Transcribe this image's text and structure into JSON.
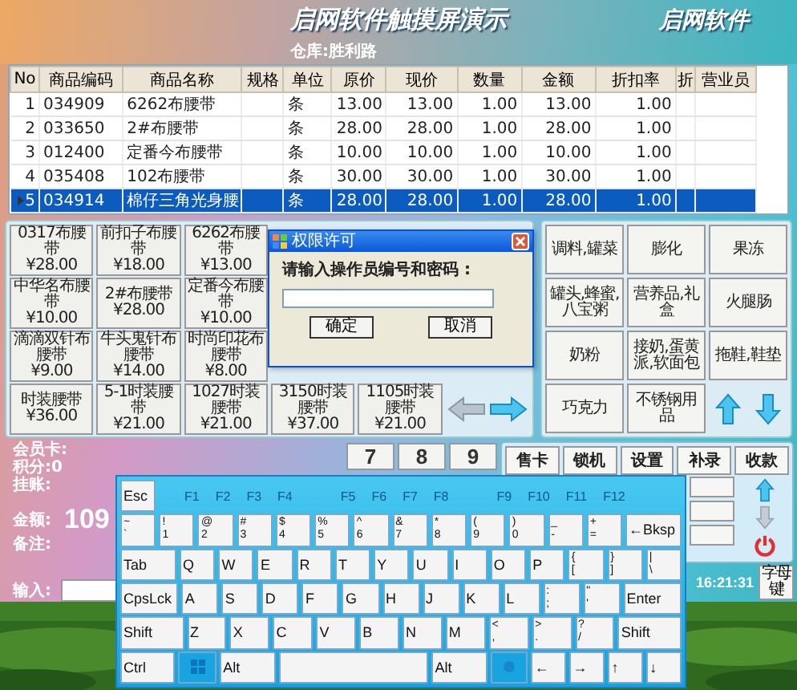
{
  "window": {
    "title": "启网软件触摸屏演示",
    "logo": "启网软件",
    "info": "仓库:胜利路"
  },
  "table": {
    "columns": [
      "No",
      "商品编码",
      "商品名称",
      "规格",
      "单位",
      "原价",
      "现价",
      "数量",
      "金额",
      "折扣率",
      "折",
      "营业员"
    ],
    "rows": [
      {
        "selected": false,
        "cells": [
          "1",
          "034909",
          "6262布腰带",
          "",
          "条",
          "13.00",
          "13.00",
          "1.00",
          "13.00",
          "1.00",
          "",
          ""
        ]
      },
      {
        "selected": false,
        "cells": [
          "2",
          "033650",
          "2#布腰带",
          "",
          "条",
          "28.00",
          "28.00",
          "1.00",
          "28.00",
          "1.00",
          "",
          ""
        ]
      },
      {
        "selected": false,
        "cells": [
          "3",
          "012400",
          "定番今布腰带",
          "",
          "条",
          "10.00",
          "10.00",
          "1.00",
          "10.00",
          "1.00",
          "",
          ""
        ]
      },
      {
        "selected": false,
        "cells": [
          "4",
          "035408",
          "102布腰带",
          "",
          "条",
          "30.00",
          "30.00",
          "1.00",
          "30.00",
          "1.00",
          "",
          ""
        ]
      },
      {
        "selected": true,
        "cells": [
          "5",
          "034914",
          "棉仔三角光身腰",
          "",
          "条",
          "28.00",
          "28.00",
          "1.00",
          "28.00",
          "1.00",
          "",
          ""
        ]
      }
    ]
  },
  "products": [
    [
      {
        "name": "0317布腰带",
        "price": "¥28.00"
      },
      {
        "name": "前扣子布腰带",
        "price": "¥18.00"
      },
      {
        "name": "6262布腰带",
        "price": "¥13.00"
      }
    ],
    [
      {
        "name": "中华名布腰带",
        "price": "¥10.00"
      },
      {
        "name": "2#布腰带",
        "price": "¥28.00"
      },
      {
        "name": "定番今布腰带",
        "price": "¥10.00"
      }
    ],
    [
      {
        "name": "滴滴双针布腰带",
        "price": "¥9.00"
      },
      {
        "name": "牛头鬼针布腰带",
        "price": "¥14.00"
      },
      {
        "name": "时尚印花布腰带",
        "price": "¥8.00"
      }
    ],
    [
      {
        "name": "时装腰带",
        "price": "¥36.00"
      },
      {
        "name": "5-1时装腰带",
        "price": "¥21.00"
      },
      {
        "name": "1027时装腰带",
        "price": "¥21.00"
      },
      {
        "name": "3150时装腰带",
        "price": "¥37.00"
      },
      {
        "name": "1105时装腰带",
        "price": "¥21.00"
      }
    ]
  ],
  "categories": [
    "调料,罐菜",
    "膨化",
    "果冻",
    "罐头,蜂蜜,八宝粥",
    "营养品,礼盒",
    "火腿肠",
    "奶粉",
    "接奶,蛋黄派,软面包",
    "拖鞋,鞋垫",
    "巧克力",
    "不锈钢用品"
  ],
  "member": {
    "card_label": "会员卡:",
    "points_label": "积分:0",
    "credit_label": "挂账:",
    "amount_label": "金额:",
    "amount": "109",
    "note_label": "备注:",
    "input_label": "输入:"
  },
  "numpad": [
    "7",
    "8",
    "9"
  ],
  "functions": [
    "售卡",
    "锁机",
    "设置",
    "补录",
    "收款"
  ],
  "status": {
    "time": "16:21:31",
    "mode_button": "字母键"
  },
  "dialog": {
    "title": "权限许可",
    "prompt": "请输入操作员编号和密码 :",
    "buttons": [
      "确定",
      "取消"
    ]
  },
  "keyboard": {
    "top_row": [
      {
        "kind": "mod",
        "label": "Esc"
      },
      {
        "kind": "fn",
        "label": "F1"
      },
      {
        "kind": "fn",
        "label": "F2"
      },
      {
        "kind": "fn",
        "label": "F3"
      },
      {
        "kind": "fn",
        "label": "F4"
      },
      {
        "kind": "fn",
        "label": "F5"
      },
      {
        "kind": "fn",
        "label": "F6"
      },
      {
        "kind": "fn",
        "label": "F7"
      },
      {
        "kind": "fn",
        "label": "F8"
      },
      {
        "kind": "fn",
        "label": "F9"
      },
      {
        "kind": "fn",
        "label": "F10"
      },
      {
        "kind": "fn",
        "label": "F11"
      },
      {
        "kind": "fn",
        "label": "F12"
      }
    ],
    "number_row": [
      {
        "kind": "pair",
        "upper": "~",
        "lower": "`"
      },
      {
        "kind": "pair",
        "upper": "!",
        "lower": "1"
      },
      {
        "kind": "pair",
        "upper": "@",
        "lower": "2"
      },
      {
        "kind": "pair",
        "upper": "#",
        "lower": "3"
      },
      {
        "kind": "pair",
        "upper": "$",
        "lower": "4"
      },
      {
        "kind": "pair",
        "upper": "%",
        "lower": "5"
      },
      {
        "kind": "pair",
        "upper": "^",
        "lower": "6"
      },
      {
        "kind": "pair",
        "upper": "&",
        "lower": "7"
      },
      {
        "kind": "pair",
        "upper": "*",
        "lower": "8"
      },
      {
        "kind": "pair",
        "upper": "(",
        "lower": "9"
      },
      {
        "kind": "pair",
        "upper": ")",
        "lower": "0"
      },
      {
        "kind": "pair",
        "upper": "_",
        "lower": "-"
      },
      {
        "kind": "pair",
        "upper": "+",
        "lower": "="
      },
      {
        "kind": "mod",
        "label": "←Bksp"
      }
    ],
    "qwerty_row": [
      {
        "kind": "mod",
        "label": "Tab"
      },
      {
        "kind": "char",
        "label": "Q"
      },
      {
        "kind": "char",
        "label": "W"
      },
      {
        "kind": "char",
        "label": "E"
      },
      {
        "kind": "char",
        "label": "R"
      },
      {
        "kind": "char",
        "label": "T"
      },
      {
        "kind": "char",
        "label": "Y"
      },
      {
        "kind": "char",
        "label": "U"
      },
      {
        "kind": "char",
        "label": "I"
      },
      {
        "kind": "char",
        "label": "O"
      },
      {
        "kind": "char",
        "label": "P"
      },
      {
        "kind": "pair",
        "upper": "{",
        "lower": "["
      },
      {
        "kind": "pair",
        "upper": "}",
        "lower": "]"
      },
      {
        "kind": "pair",
        "upper": "|",
        "lower": "\\"
      }
    ],
    "home_row": [
      {
        "kind": "mod",
        "label": "CpsLck"
      },
      {
        "kind": "char",
        "label": "A"
      },
      {
        "kind": "char",
        "label": "S"
      },
      {
        "kind": "char",
        "label": "D"
      },
      {
        "kind": "char",
        "label": "F"
      },
      {
        "kind": "char",
        "label": "G"
      },
      {
        "kind": "char",
        "label": "H"
      },
      {
        "kind": "char",
        "label": "J"
      },
      {
        "kind": "char",
        "label": "K"
      },
      {
        "kind": "char",
        "label": "L"
      },
      {
        "kind": "pair",
        "upper": ":",
        "lower": ";"
      },
      {
        "kind": "pair",
        "upper": "\"",
        "lower": "'"
      },
      {
        "kind": "mod",
        "label": "Enter"
      }
    ],
    "shift_row": [
      {
        "kind": "mod",
        "label": "Shift"
      },
      {
        "kind": "char",
        "label": "Z"
      },
      {
        "kind": "char",
        "label": "X"
      },
      {
        "kind": "char",
        "label": "C"
      },
      {
        "kind": "char",
        "label": "V"
      },
      {
        "kind": "char",
        "label": "B"
      },
      {
        "kind": "char",
        "label": "N"
      },
      {
        "kind": "char",
        "label": "M"
      },
      {
        "kind": "pair",
        "upper": "<",
        "lower": ","
      },
      {
        "kind": "pair",
        "upper": ">",
        "lower": "."
      },
      {
        "kind": "pair",
        "upper": "?",
        "lower": "/"
      },
      {
        "kind": "mod",
        "label": "Shift"
      }
    ],
    "bottom_row": [
      {
        "kind": "mod",
        "label": "Ctrl"
      },
      {
        "kind": "win"
      },
      {
        "kind": "mod",
        "label": "Alt"
      },
      {
        "kind": "space"
      },
      {
        "kind": "mod",
        "label": "Alt"
      },
      {
        "kind": "menu"
      },
      {
        "kind": "char",
        "label": "←"
      },
      {
        "kind": "char",
        "label": "→"
      },
      {
        "kind": "char",
        "label": "↑"
      },
      {
        "kind": "char",
        "label": "↓"
      }
    ]
  }
}
